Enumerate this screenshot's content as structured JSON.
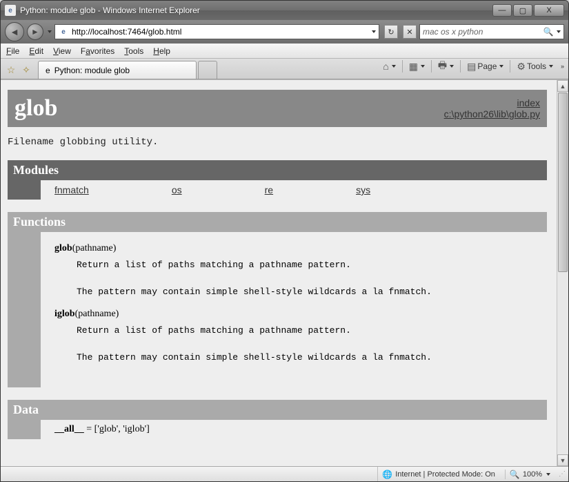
{
  "window": {
    "title": "Python: module glob - Windows Internet Explorer",
    "controls": {
      "min": "—",
      "max": "▢",
      "close": "X"
    }
  },
  "nav": {
    "url": "http://localhost:7464/glob.html",
    "refresh_glyph": "↻",
    "stop_glyph": "✕",
    "search_value": "mac os x python",
    "search_glyph": "🔍"
  },
  "menu": {
    "file": "File",
    "edit": "Edit",
    "view": "View",
    "favorites": "Favorites",
    "tools": "Tools",
    "help": "Help"
  },
  "tab": {
    "title": "Python: module glob"
  },
  "toolbar": {
    "home_glyph": "⌂",
    "feeds_glyph": "▦",
    "print_glyph": "🖶",
    "page_label": "Page",
    "tools_label": "Tools"
  },
  "pydoc": {
    "module_name": "glob",
    "index_label": "index",
    "source_path": "c:\\python26\\lib\\glob.py",
    "description": "Filename globbing utility.",
    "modules_heading": "Modules",
    "modules": [
      "fnmatch",
      "os",
      "re",
      "sys"
    ],
    "functions_heading": "Functions",
    "functions": [
      {
        "name": "glob",
        "args": "(pathname)",
        "doc": "Return a list of paths matching a pathname pattern.\n\nThe pattern may contain simple shell-style wildcards a la fnmatch."
      },
      {
        "name": "iglob",
        "args": "(pathname)",
        "doc": "Return a list of paths matching a pathname pattern.\n\nThe pattern may contain simple shell-style wildcards a la fnmatch."
      }
    ],
    "data_heading": "Data",
    "data_name": "__all__",
    "data_value": " = ['glob', 'iglob']"
  },
  "status": {
    "done": "",
    "zone": "Internet | Protected Mode: On",
    "zoom": "100%"
  }
}
